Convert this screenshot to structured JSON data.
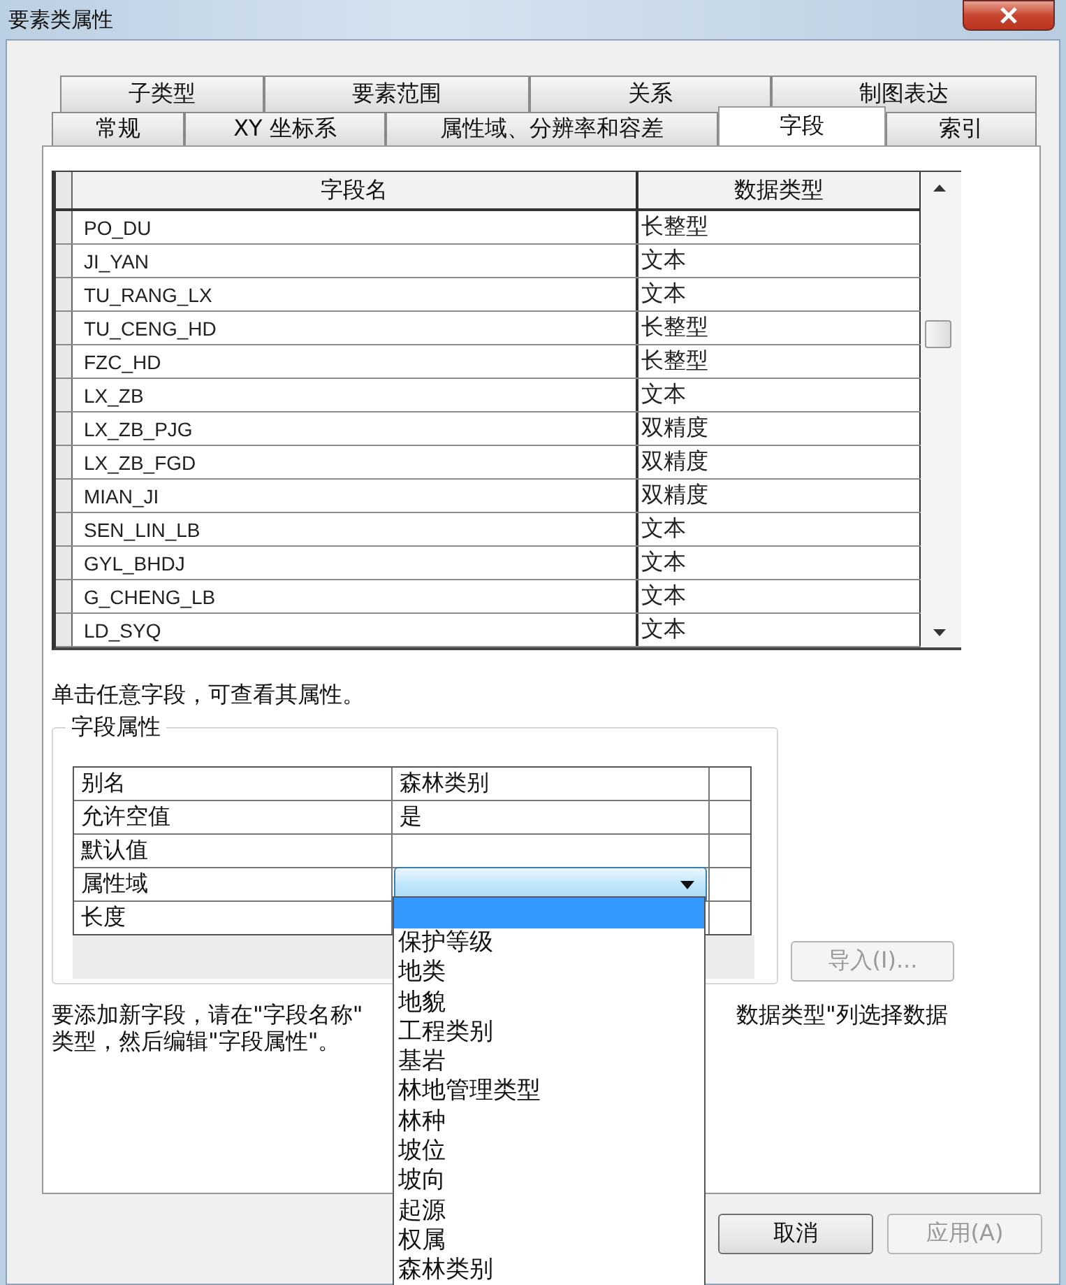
{
  "window": {
    "title": "要素类属性"
  },
  "tabs_back": [
    {
      "label": "子类型",
      "selected": false
    },
    {
      "label": "要素范围",
      "selected": false
    },
    {
      "label": "关系",
      "selected": false
    },
    {
      "label": "制图表达",
      "selected": false
    }
  ],
  "tabs_front": [
    {
      "label": "常规",
      "selected": false
    },
    {
      "label": "XY 坐标系",
      "selected": false
    },
    {
      "label": "属性域、分辨率和容差",
      "selected": false
    },
    {
      "label": "字段",
      "selected": true
    },
    {
      "label": "索引",
      "selected": false
    }
  ],
  "fields_table": {
    "columns": [
      "字段名",
      "数据类型"
    ],
    "rows": [
      {
        "name": "PO_DU",
        "type": "长整型"
      },
      {
        "name": "JI_YAN",
        "type": "文本"
      },
      {
        "name": "TU_RANG_LX",
        "type": "文本"
      },
      {
        "name": "TU_CENG_HD",
        "type": "长整型"
      },
      {
        "name": "FZC_HD",
        "type": "长整型"
      },
      {
        "name": "LX_ZB",
        "type": "文本"
      },
      {
        "name": "LX_ZB_PJG",
        "type": "双精度"
      },
      {
        "name": "LX_ZB_FGD",
        "type": "双精度"
      },
      {
        "name": "MIAN_JI",
        "type": "双精度"
      },
      {
        "name": "SEN_LIN_LB",
        "type": "文本"
      },
      {
        "name": "GYL_BHDJ",
        "type": "文本"
      },
      {
        "name": "G_CHENG_LB",
        "type": "文本"
      },
      {
        "name": "LD_SYQ",
        "type": "文本"
      }
    ]
  },
  "hint": "单击任意字段，可查看其属性。",
  "field_properties": {
    "title": "字段属性",
    "rows": [
      {
        "kind": "text",
        "label": "别名",
        "value": "森林类别"
      },
      {
        "kind": "text",
        "label": "允许空值",
        "value": "是"
      },
      {
        "kind": "text",
        "label": "默认值"
      },
      {
        "kind": "dropdown",
        "label": "属性域"
      },
      {
        "kind": "text",
        "label": "长度"
      }
    ]
  },
  "import_button": {
    "label": "导入(I)...",
    "disabled": true
  },
  "note": {
    "left_lines": [
      "要添加新字段，请在\"字段名称\"",
      "类型，然后编辑\"字段属性\"。"
    ],
    "right_text": "数据类型\"列选择数据"
  },
  "domain_dropdown": {
    "expanded": true,
    "blank_option_selected": true,
    "options": [
      {
        "label": "保护等级"
      },
      {
        "label": "地类"
      },
      {
        "label": "地貌"
      },
      {
        "label": "工程类别"
      },
      {
        "label": "基岩"
      },
      {
        "label": "林地管理类型"
      },
      {
        "label": "林种"
      },
      {
        "label": "坡位"
      },
      {
        "label": "坡向"
      },
      {
        "label": "起源"
      },
      {
        "label": "权属"
      },
      {
        "label": "森林类别"
      }
    ]
  },
  "buttons": [
    {
      "label": "取消",
      "disabled": false
    },
    {
      "label": "应用(A)",
      "disabled": true
    }
  ]
}
